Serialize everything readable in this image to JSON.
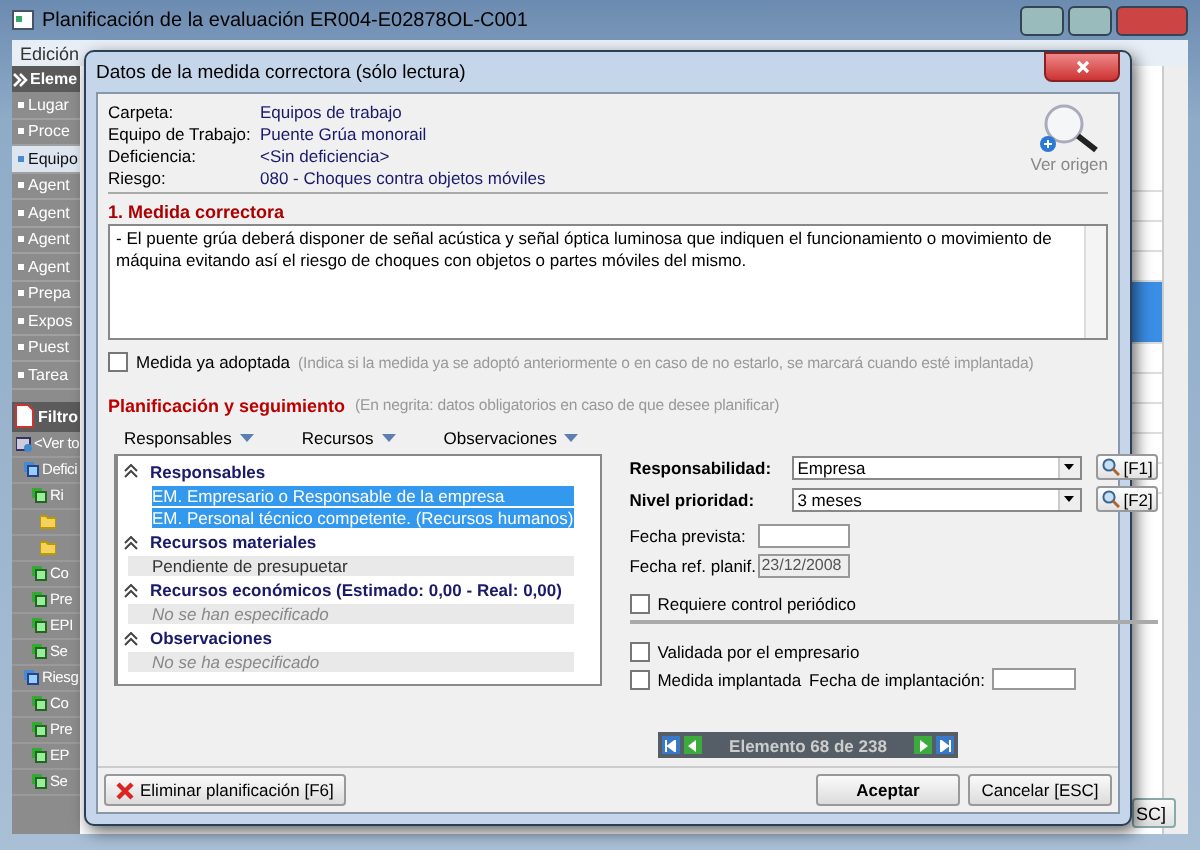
{
  "main_window": {
    "title": "Planificación de la evaluación ER004-E02878OL-C001",
    "menu": [
      "Edición"
    ],
    "sidebar": {
      "header": "Eleme",
      "items": [
        {
          "label": "Lugar",
          "selected": false
        },
        {
          "label": "Proce",
          "selected": false
        },
        {
          "label": "Equipo",
          "selected": true
        },
        {
          "label": "Agent",
          "selected": false
        },
        {
          "label": "Agent",
          "selected": false
        },
        {
          "label": "Agent",
          "selected": false
        },
        {
          "label": "Agent",
          "selected": false
        },
        {
          "label": "Prepa",
          "selected": false
        },
        {
          "label": "Expos",
          "selected": false
        },
        {
          "label": "Puest",
          "selected": false
        },
        {
          "label": "Tarea",
          "selected": false
        }
      ],
      "filter": "Filtro",
      "tree": [
        {
          "label": "<Ver to",
          "kind": "view",
          "children": [
            {
              "label": "Defici",
              "kind": "group",
              "children": [
                {
                  "label": "Ri",
                  "kind": "item",
                  "children": [
                    {
                      "kind": "folder"
                    },
                    {
                      "kind": "folder"
                    }
                  ]
                },
                {
                  "label": "Co",
                  "kind": "item"
                },
                {
                  "label": "Pre",
                  "kind": "item"
                },
                {
                  "label": "EPI",
                  "kind": "item"
                },
                {
                  "label": "Se",
                  "kind": "item"
                }
              ]
            },
            {
              "label": "Riesg",
              "kind": "group",
              "children": [
                {
                  "label": "Co",
                  "kind": "item"
                },
                {
                  "label": "Pre",
                  "kind": "item"
                },
                {
                  "label": "EP",
                  "kind": "item"
                },
                {
                  "label": "Se",
                  "kind": "item"
                }
              ]
            }
          ]
        }
      ]
    },
    "cancel_button_partial": "SC]"
  },
  "dialog": {
    "title": "Datos de la medida correctora  (sólo lectura)",
    "info": [
      {
        "label": "Carpeta:",
        "value": "Equipos de trabajo"
      },
      {
        "label": "Equipo de Trabajo:",
        "value": "Puente Grúa monorail"
      },
      {
        "label": "Deficiencia:",
        "value": "<Sin deficiencia>"
      },
      {
        "label": "Riesgo:",
        "value": "080 - Choques contra objetos móviles"
      }
    ],
    "view_origin": "Ver origen",
    "measure": {
      "heading": "1. Medida correctora",
      "text": "- El puente grúa deberá disponer de señal acústica y señal óptica luminosa que indiquen el funcionamiento o movimiento de máquina evitando así el riesgo de choques con objetos o partes móviles del mismo."
    },
    "adopted": {
      "label": "Medida ya adoptada",
      "hint": "(Indica si la medida ya se adoptó anteriormente o en caso de no estarlo, se marcará cuando esté implantada)",
      "checked": false
    },
    "planning": {
      "heading": "Planificación y seguimiento",
      "hint": "(En negrita: datos obligatorios en caso de que desee planificar)"
    },
    "menus": [
      "Responsables",
      "Recursos",
      "Observaciones"
    ],
    "sections": [
      {
        "title": "Responsables",
        "items": [
          {
            "text": "EM. Empresario o Responsable de la empresa",
            "kind": "entry",
            "selected": true
          },
          {
            "text": "EM. Personal técnico competente. (Recursos humanos)",
            "kind": "entry",
            "selected": true
          }
        ]
      },
      {
        "title": "Recursos materiales",
        "items": [
          {
            "text": "Pendiente de presupuetar",
            "kind": "entry",
            "selected": false
          }
        ]
      },
      {
        "title": "Recursos económicos (Estimado: 0,00 - Real: 0,00)",
        "items": [
          {
            "text": "No se han especificado",
            "kind": "empty",
            "selected": false
          }
        ]
      },
      {
        "title": "Observaciones",
        "items": [
          {
            "text": "No se ha especificado",
            "kind": "empty",
            "selected": false
          }
        ]
      }
    ],
    "selects": [
      {
        "label": "Responsabilidad:",
        "value": "Empresa",
        "button": "[F1]"
      },
      {
        "label": "Nivel prioridad:",
        "value": "3 meses",
        "button": "[F2]"
      }
    ],
    "dates": [
      {
        "label": "Fecha prevista:",
        "disabled": false
      },
      {
        "label": "Fecha ref. planif.",
        "value": "23/12/2008",
        "disabled": true
      }
    ],
    "periodic": {
      "label": "Requiere control periódico",
      "checked": false
    },
    "validated": {
      "label": "Validada por el empresario",
      "checked": false
    },
    "implemented": {
      "label": "Medida implantada",
      "checked": false,
      "date_label": "Fecha de implantación:"
    },
    "navigator": "Elemento 68 de 238",
    "delete_button": "Eliminar planificación  [F6]",
    "buttons": [
      "Aceptar",
      "Cancelar [ESC]"
    ]
  }
}
